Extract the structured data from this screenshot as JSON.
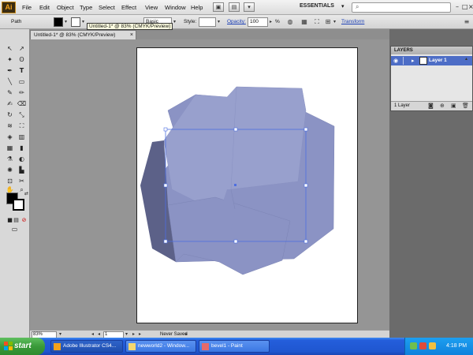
{
  "app": {
    "logo": "Ai"
  },
  "menu": [
    "File",
    "Edit",
    "Object",
    "Type",
    "Select",
    "Effect",
    "View",
    "Window",
    "Help"
  ],
  "workspace": "ESSENTIALS",
  "search": {
    "placeholder": "",
    "value": ""
  },
  "control_bar": {
    "selection_type": "Path",
    "style_label": "Style:",
    "brush_value": "Basic",
    "opacity_label": "Opacity:",
    "opacity_value": "100",
    "opacity_unit": "%",
    "transform_label": "Transform",
    "fill_color": "#000000",
    "stroke_color": "#ffffff"
  },
  "tooltip": "Untitled-1* @ 83% (CMYK/Preview)",
  "document_tab": {
    "label": "Untitled-1* @ 83% (CMYK/Preview)",
    "close": "×"
  },
  "status_bar": {
    "zoom": "83%",
    "page": "1",
    "status": "Never Saved"
  },
  "layers_panel": {
    "title": "LAYERS",
    "layers": [
      {
        "name": "Layer 1",
        "color": "#4d6dc6"
      }
    ],
    "count_label": "1 Layer"
  },
  "artwork": {
    "fill_light": "#98a0cd",
    "fill_mid": "#8b93c4",
    "fill_dark": "#5c6188",
    "selection_color": "#4d6fe0"
  },
  "taskbar": {
    "start_label": "start",
    "tasks": [
      {
        "label": "Adobe Illustrator CS4...",
        "icon": "illustrator-icon"
      },
      {
        "label": "newworld2 - Window...",
        "icon": "folder-icon"
      },
      {
        "label": "bevel1 - Paint",
        "icon": "paint-icon"
      }
    ],
    "clock": "4:18 PM"
  }
}
